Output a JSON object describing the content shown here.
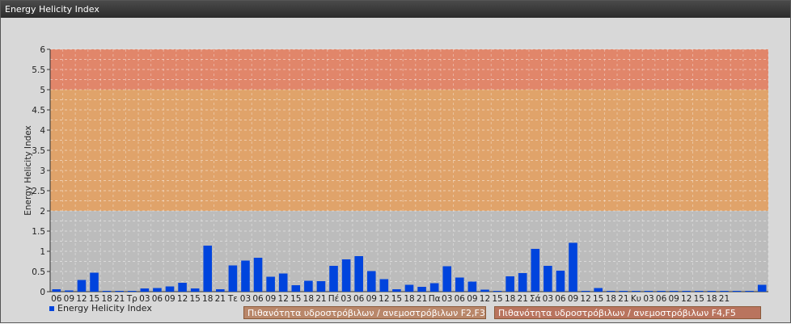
{
  "window": {
    "title": "Energy Helicity Index"
  },
  "chart_data": {
    "type": "bar",
    "ylabel": "Energy Helicity Index",
    "ylim": [
      0,
      6
    ],
    "yticks": [
      "0",
      "0.5",
      "1",
      "1.5",
      "2",
      "2.5",
      "3",
      "3.5",
      "4",
      "4.5",
      "5",
      "5.5",
      "6"
    ],
    "bands": [
      {
        "from": 2,
        "to": 5,
        "color": "#e3a060",
        "label": "Πιθανότητα υδροστρόβιλων / ανεμοστρόβιλων F2,F3"
      },
      {
        "from": 5,
        "to": 6,
        "color": "#e48060",
        "label": "Πιθανότητα υδροστρόβιλων / ανεμοστρόβιλων F4,F5"
      }
    ],
    "series": [
      {
        "name": "Energy Helicity Index",
        "color": "#0044dd",
        "values": [
          0.06,
          0.03,
          0.29,
          0.47,
          0.02,
          0.02,
          0.02,
          0.08,
          0.09,
          0.13,
          0.22,
          0.08,
          1.14,
          0.06,
          0.65,
          0.77,
          0.84,
          0.37,
          0.45,
          0.16,
          0.27,
          0.26,
          0.64,
          0.8,
          0.88,
          0.51,
          0.31,
          0.06,
          0.17,
          0.12,
          0.21,
          0.63,
          0.35,
          0.25,
          0.05,
          0.02,
          0.38,
          0.46,
          1.06,
          0.64,
          0.52,
          1.21,
          0.02,
          0.09,
          0.02,
          0.02,
          0.02,
          0.02,
          0.02,
          0.02,
          0.02,
          0.02,
          0.02,
          0.02,
          0.02,
          0.02,
          0.17
        ]
      }
    ],
    "categories": [
      "06",
      "09",
      "12",
      "15",
      "18",
      "21",
      "Τρ",
      "03",
      "06",
      "09",
      "12",
      "15",
      "18",
      "21",
      "Τε",
      "03",
      "06",
      "09",
      "12",
      "15",
      "18",
      "21",
      "Πέ",
      "03",
      "06",
      "09",
      "12",
      "15",
      "18",
      "21",
      "Πα",
      "03",
      "06",
      "09",
      "12",
      "15",
      "18",
      "21",
      "Σά",
      "03",
      "06",
      "09",
      "12",
      "15",
      "18",
      "21",
      "Κυ",
      "03",
      "06",
      "09",
      "12",
      "15",
      "18",
      "21"
    ],
    "grid": true,
    "legend": "bottom"
  }
}
